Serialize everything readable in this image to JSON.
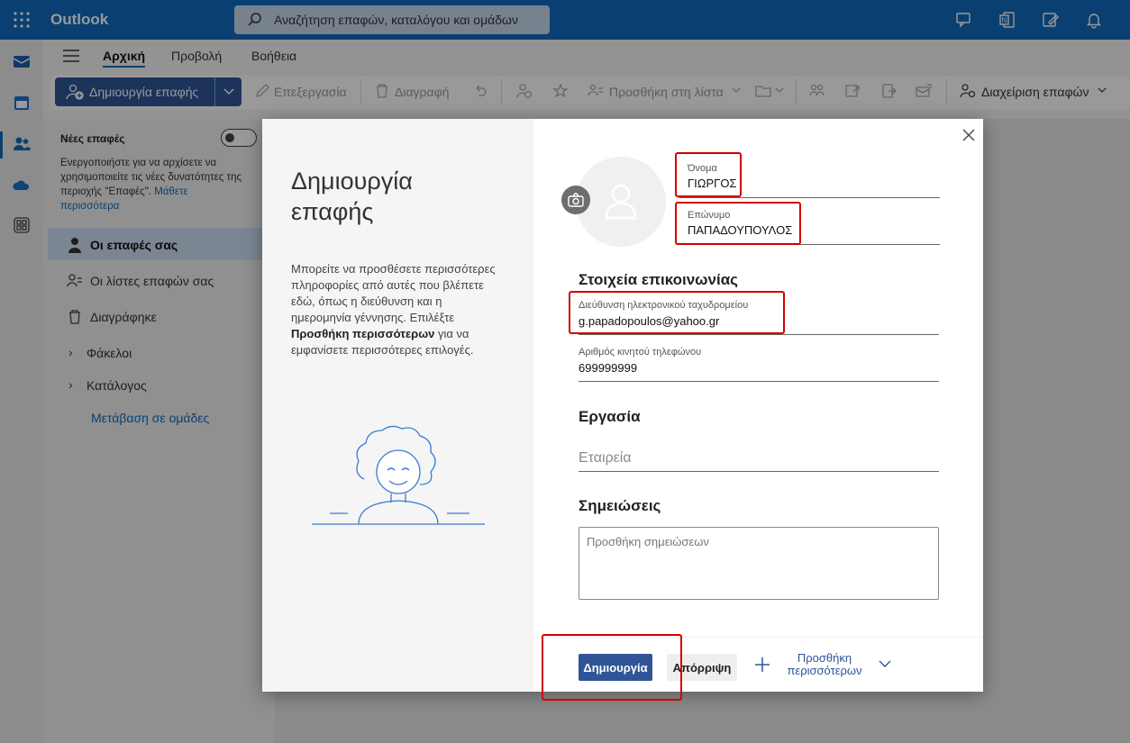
{
  "app": {
    "brand": "Outlook",
    "search_placeholder": "Αναζήτηση επαφών, καταλόγου και ομάδων"
  },
  "tabs": [
    {
      "label": "Αρχική",
      "active": true
    },
    {
      "label": "Προβολή"
    },
    {
      "label": "Βοήθεια"
    }
  ],
  "toolbar": {
    "new_contact": "Δημιουργία επαφής",
    "edit": "Επεξεργασία",
    "delete": "Διαγραφή",
    "add_to_list": "Προσθήκη στη λίστα",
    "manage_contacts": "Διαχείριση επαφών"
  },
  "sidebar": {
    "new_contacts_title": "Νέες επαφές",
    "new_contacts_desc": "Ενεργοποιήστε για να αρχίσετε να χρησιμοποιείτε τις νέες δυνατότητες της περιοχής \"Επαφές\".",
    "learn_more": "Μάθετε περισσότερα",
    "items": [
      {
        "label": "Οι επαφές σας",
        "selected": true
      },
      {
        "label": "Οι λίστες επαφών σας"
      },
      {
        "label": "Διαγράφηκε"
      },
      {
        "label": "Φάκελοι"
      },
      {
        "label": "Κατάλογος"
      }
    ],
    "groups_link": "Μετάβαση σε ομάδες"
  },
  "dialog": {
    "title": "Δημιουργία επαφής",
    "desc_before": "Μπορείτε να προσθέσετε περισσότερες πληροφορίες από αυτές που βλέπετε εδώ, όπως η διεύθυνση και η ημερομηνία γέννησης. Επιλέξτε ",
    "desc_bold": "Προσθήκη περισσότερων",
    "desc_after": " για να εμφανίσετε περισσότερες επιλογές.",
    "first_name_label": "Όνομα",
    "first_name_value": "ΓΙΩΡΓΟΣ",
    "last_name_label": "Επώνυμο",
    "last_name_value": "ΠΑΠΑΔΟΥΠΟΥΛΟΣ",
    "contact_section": "Στοιχεία επικοινωνίας",
    "email_label": "Διεύθυνση ηλεκτρονικού ταχυδρομείου",
    "email_value": "g.papadopoulos@yahoo.gr",
    "phone_label": "Αριθμός κινητού τηλεφώνου",
    "phone_value": "699999999",
    "work_section": "Εργασία",
    "company_placeholder": "Εταιρεία",
    "notes_section": "Σημειώσεις",
    "notes_placeholder": "Προσθήκη σημειώσεων",
    "create_button": "Δημιουργία",
    "cancel_button": "Απόρριψη",
    "more_button": "Προσθήκη περισσότερων"
  },
  "colors": {
    "brand": "#0f6cbd",
    "primary_button": "#2f5597",
    "highlight": "#d10000"
  }
}
